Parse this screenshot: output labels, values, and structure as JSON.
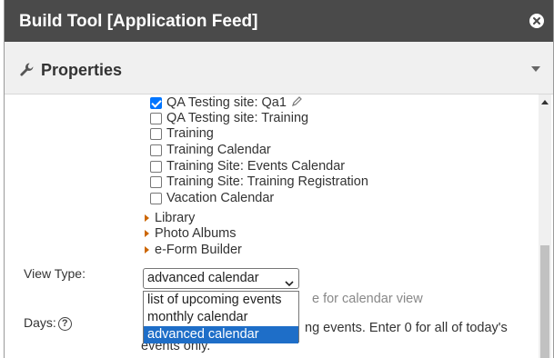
{
  "dialog": {
    "title": "Build Tool [Application Feed]",
    "close_icon": "close-circle-icon"
  },
  "panel": {
    "title": "Properties",
    "icon": "wrench-icon"
  },
  "sites": [
    {
      "label": "QA Testing site: Qa1",
      "checked": true,
      "editable": true
    },
    {
      "label": "QA Testing site: Training",
      "checked": false
    },
    {
      "label": "Training",
      "checked": false
    },
    {
      "label": "Training Calendar",
      "checked": false
    },
    {
      "label": "Training Site: Events Calendar",
      "checked": false
    },
    {
      "label": "Training Site: Training Registration",
      "checked": false
    },
    {
      "label": "Vacation Calendar",
      "checked": false
    }
  ],
  "tree": [
    {
      "label": "Library"
    },
    {
      "label": "Photo Albums"
    },
    {
      "label": "e-Form Builder"
    }
  ],
  "view_type": {
    "label": "View Type:",
    "selected": "advanced calendar",
    "options": [
      "list of upcoming events",
      "monthly calendar",
      "advanced calendar"
    ],
    "hint_visible": "e for calendar view"
  },
  "days": {
    "label": "Days:",
    "description_line1": "ng events. Enter 0 for all of today's",
    "description_line2": "events only."
  },
  "colors": {
    "titlebar": "#4a4a4a",
    "accent": "#0075ff",
    "selected_option": "#1e6ec8",
    "tree_arrow": "#cc6600"
  }
}
